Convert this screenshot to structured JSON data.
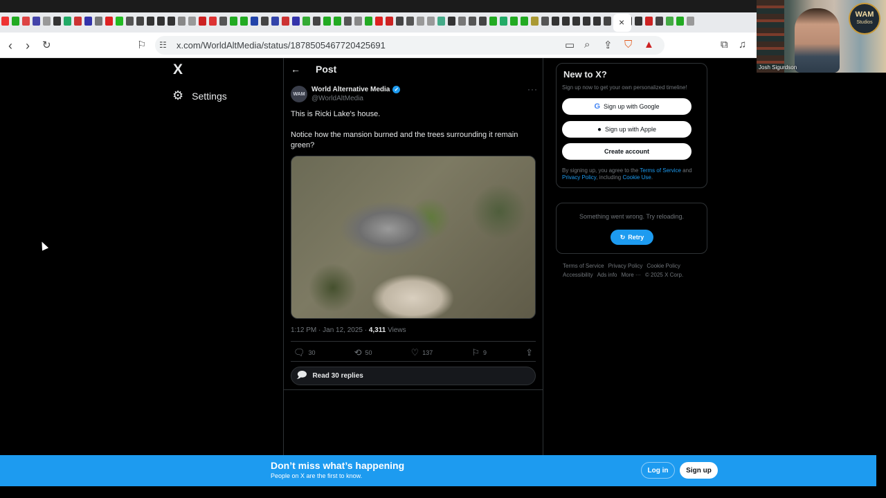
{
  "browser": {
    "url": "x.com/WorldAltMedia/status/1878505467720425691",
    "tab_close": "×",
    "tab_colors": [
      "#e33",
      "#2a2",
      "#d44",
      "#44a",
      "#999",
      "#333",
      "#2a6",
      "#c33",
      "#33a",
      "#777",
      "#d22",
      "#2b2",
      "#555",
      "#444",
      "#333",
      "#333",
      "#333",
      "#888",
      "#999",
      "#c22",
      "#d33",
      "#555",
      "#2a2",
      "#2a2",
      "#24a",
      "#444",
      "#34a",
      "#c33",
      "#33a",
      "#3a3",
      "#444",
      "#2a2",
      "#2a2",
      "#555",
      "#888",
      "#2a2",
      "#d22",
      "#c22",
      "#444",
      "#555",
      "#999",
      "#999",
      "#4a8",
      "#333",
      "#777",
      "#555",
      "#444",
      "#2a2",
      "#2a6",
      "#2a2",
      "#2a2",
      "#a93",
      "#555",
      "#333",
      "#333",
      "#333",
      "#333",
      "#333",
      "#444",
      "#c22",
      "#333",
      "#333",
      "#c22",
      "#444",
      "#4a4",
      "#2a2",
      "#999"
    ],
    "icons": {
      "back": "back-arrow-icon",
      "forward": "forward-arrow-icon",
      "reload": "reload-icon",
      "bookmark": "bookmark-icon",
      "site_settings": "site-settings-icon",
      "cast": "cast-icon",
      "zoom": "zoom-icon",
      "share": "share-icon",
      "brave": "brave-shield-icon",
      "rewards": "rewards-icon",
      "extensions": "extensions-icon",
      "playlist": "playlist-icon"
    }
  },
  "sidebar": {
    "logo": "X",
    "settings_label": "Settings"
  },
  "post": {
    "header_title": "Post",
    "author_name": "World Alternative Media",
    "author_handle": "@WorldAltMedia",
    "avatar_text": "WAM",
    "verified": "✓",
    "more": "···",
    "text_line1": "This is Ricki Lake's house.",
    "text_line2": "Notice how the mansion burned and the trees surrounding it remain green?",
    "timestamp": "1:12 PM · Jan 12, 2025 · ",
    "views_count": "4,311",
    "views_label": " Views",
    "replies": "30",
    "reposts": "50",
    "likes": "137",
    "bookmarks": "9",
    "read_replies": "Read 30 replies"
  },
  "signup_card": {
    "title": "New to X?",
    "subtitle": "Sign up now to get your own personalized timeline!",
    "google_label": "Sign up with Google",
    "apple_label": "Sign up with Apple",
    "create_label": "Create account",
    "terms_prefix": "By signing up, you agree to the ",
    "terms_link": "Terms of Service",
    "terms_and": " and ",
    "privacy_link": "Privacy Policy",
    "terms_including": ", including ",
    "cookie_link": "Cookie Use",
    "terms_end": "."
  },
  "error_card": {
    "message": "Something went wrong. Try reloading.",
    "retry_label": "Retry"
  },
  "footer": {
    "links": [
      "Terms of Service",
      "Privacy Policy",
      "Cookie Policy",
      "Accessibility",
      "Ads info",
      "More ···",
      "© 2025 X Corp."
    ]
  },
  "bottom_bar": {
    "title": "Don’t miss what’s happening",
    "subtitle": "People on X are the first to know.",
    "login_label": "Log in",
    "signup_label": "Sign up"
  },
  "webcam": {
    "name": "Josh Sigurdson",
    "logo_line1": "WAM",
    "logo_line2": "Studios"
  },
  "colors": {
    "accent": "#1d9bf0",
    "background": "#000000",
    "border": "#2f3336",
    "muted_text": "#71767b"
  }
}
